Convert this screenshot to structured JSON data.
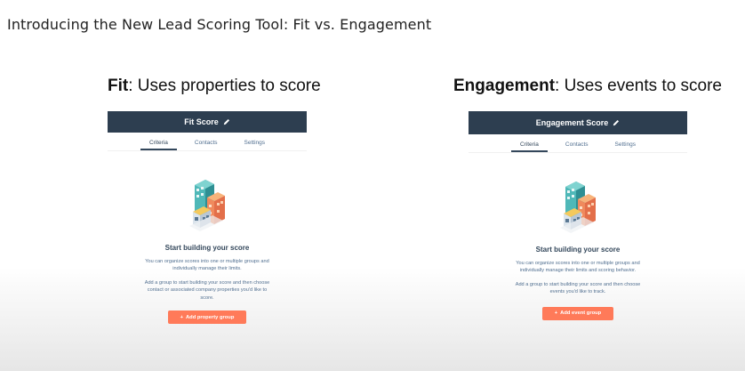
{
  "slide": {
    "title": "Introducing the New Lead Scoring Tool: Fit vs. Engagement"
  },
  "fit": {
    "heading_strong": "Fit",
    "heading_rest": ": Uses properties to score",
    "score_title": "Fit Score",
    "tabs": [
      "Criteria",
      "Contacts",
      "Settings"
    ],
    "active_tab": "Criteria",
    "empty_title": "Start building your score",
    "para1": "You can organize scores into one or multiple groups and individually manage their limits.",
    "para2": "Add a group to start building your score and then choose contact or associated company properties you'd like to score.",
    "button_label": "Add property group"
  },
  "engagement": {
    "heading_strong": "Engagement",
    "heading_rest": ": Uses events to score",
    "score_title": "Engagement Score",
    "tabs": [
      "Criteria",
      "Contacts",
      "Settings"
    ],
    "active_tab": "Criteria",
    "empty_title": "Start building your score",
    "para1": "You can organize scores into one or multiple groups and individually manage their limits and scoring behavior.",
    "para2": "Add a group to start building your score and then choose events you'd like to track.",
    "button_label": "Add event group"
  },
  "icons": {
    "edit": "pencil-icon",
    "add": "plus-icon",
    "illustration": "buildings-illustration"
  },
  "colors": {
    "header_bg": "#2d3e50",
    "button_bg": "#ff7a59",
    "text_primary": "#33475b",
    "text_secondary": "#516f90"
  }
}
